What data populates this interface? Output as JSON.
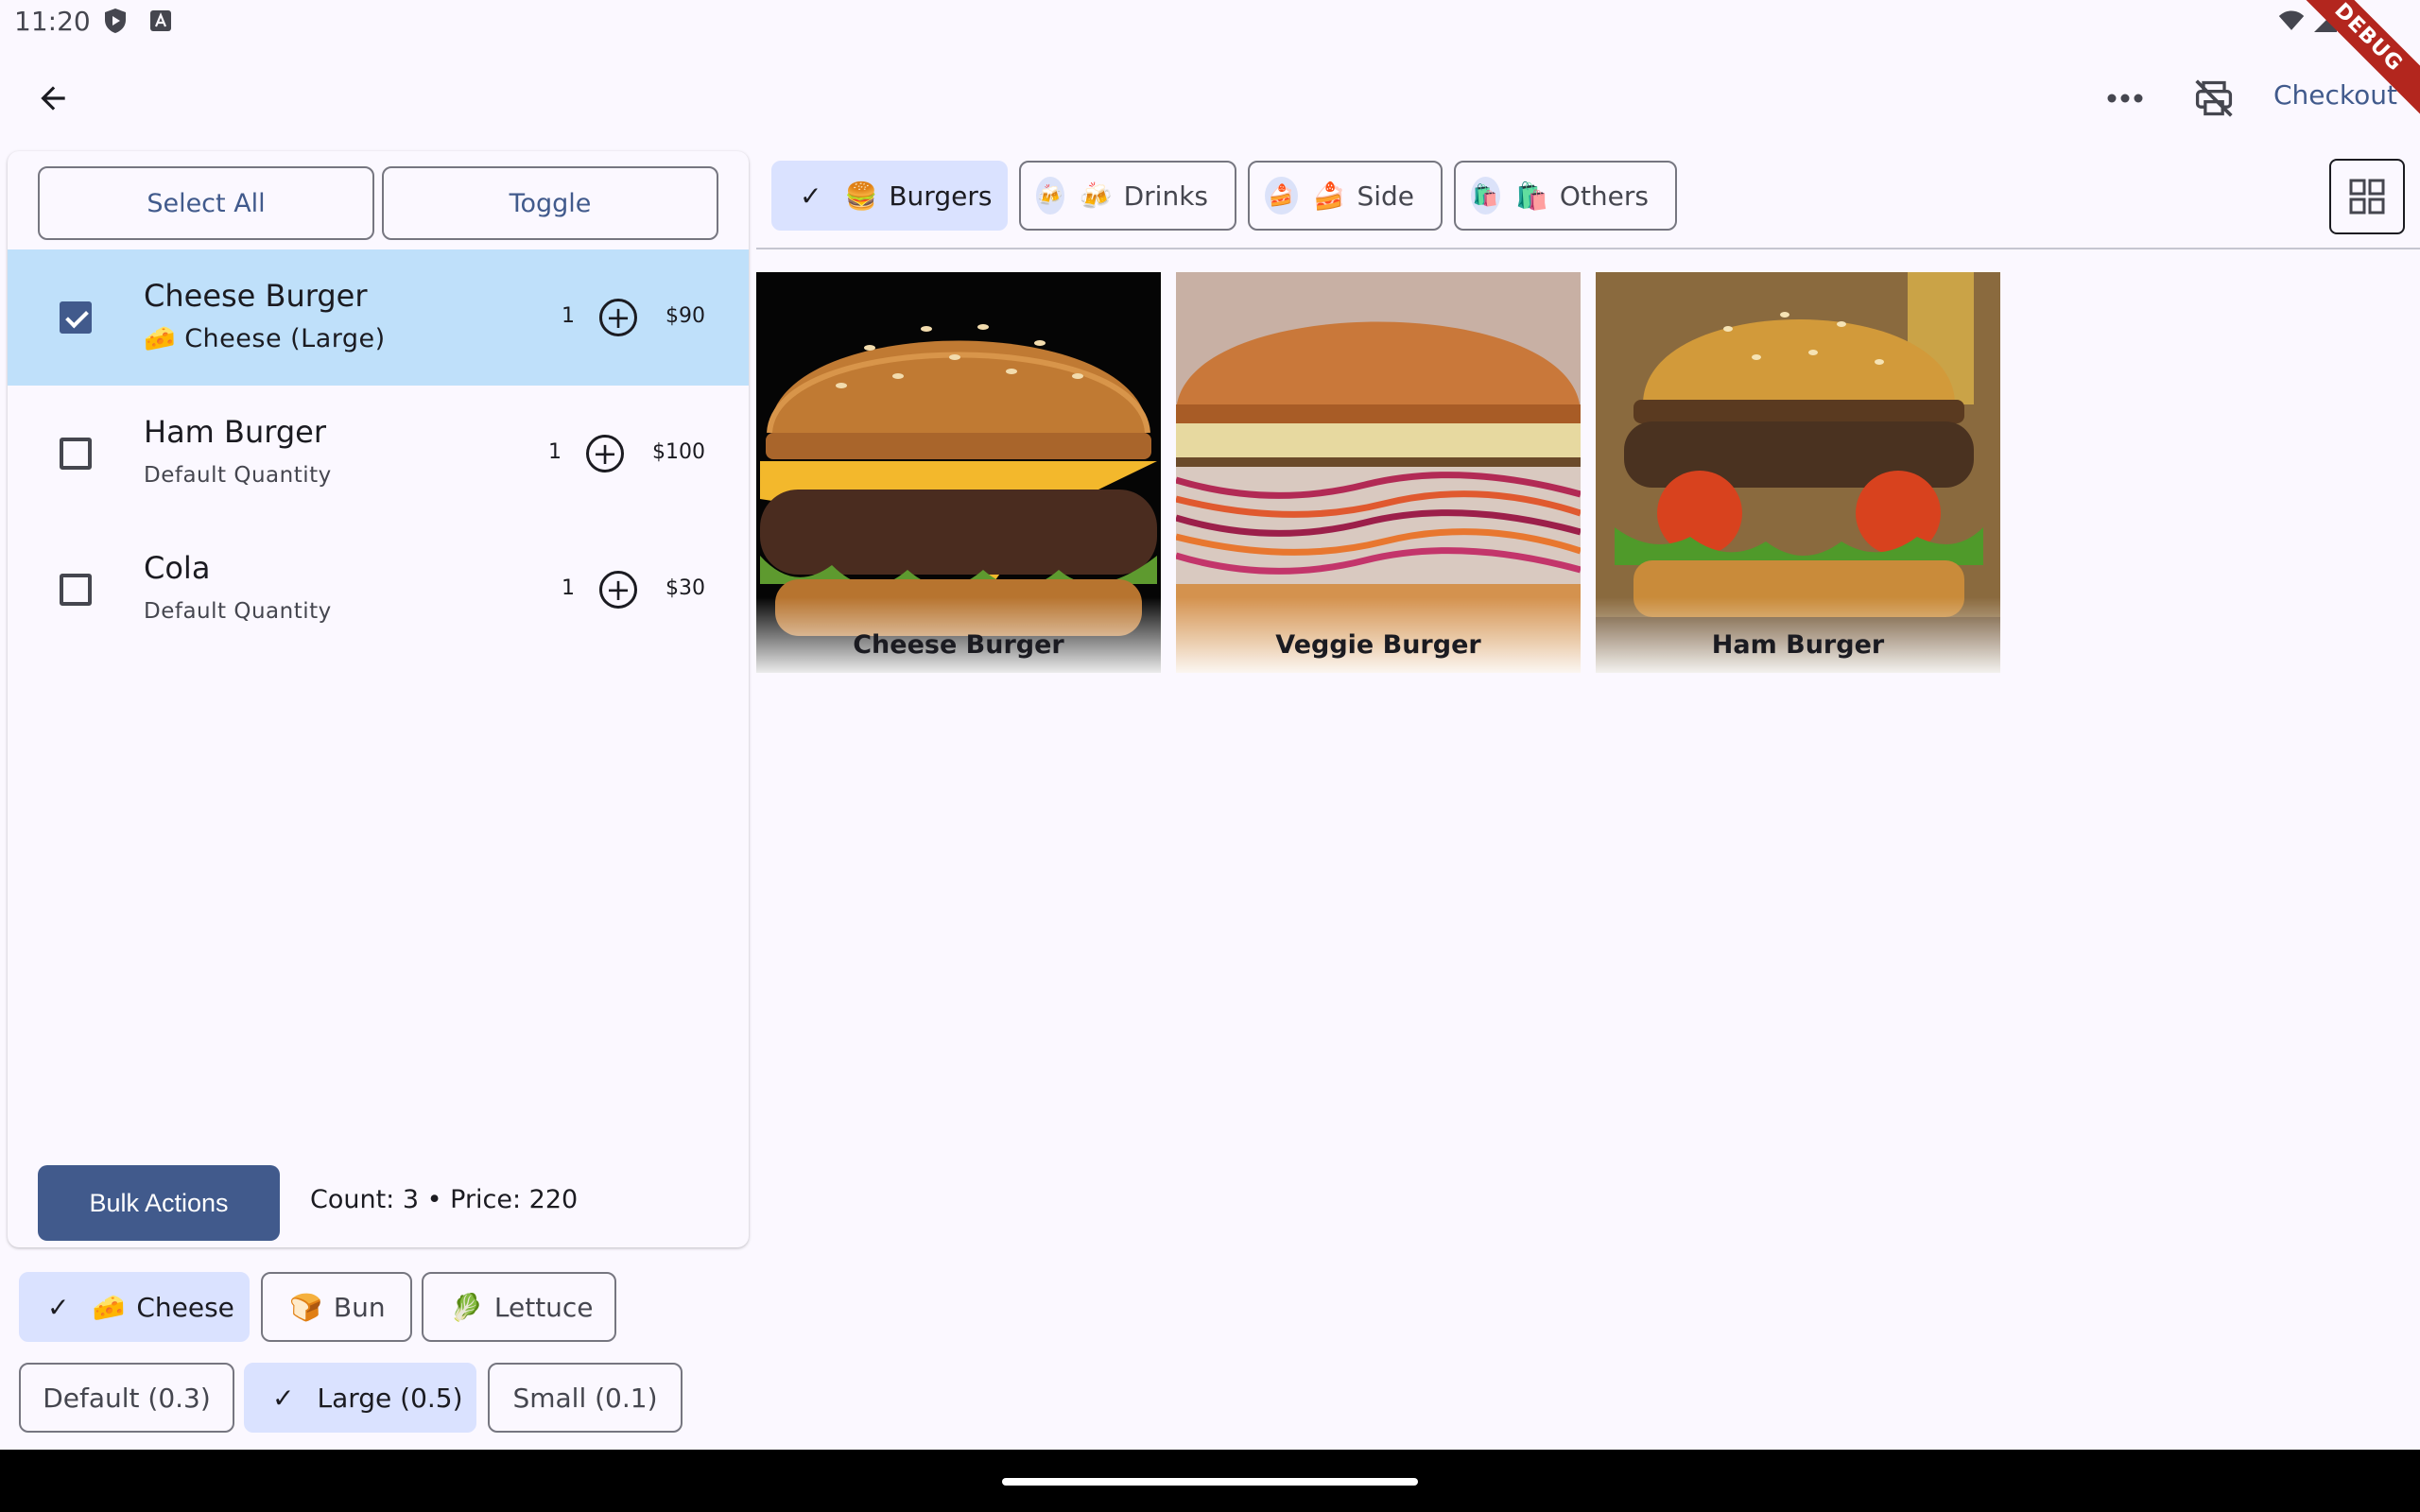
{
  "status_bar": {
    "time": "11:20",
    "debug_label": "DEBUG"
  },
  "app_bar": {
    "checkout_label": "Checkout"
  },
  "order_panel": {
    "select_all_label": "Select All",
    "toggle_label": "Toggle",
    "items": [
      {
        "name": "Cheese Burger",
        "detail": "🧀 Cheese (Large)",
        "qty": "1",
        "price": "$90",
        "checked": true
      },
      {
        "name": "Ham Burger",
        "detail": "Default Quantity",
        "qty": "1",
        "price": "$100",
        "checked": false
      },
      {
        "name": "Cola",
        "detail": "Default Quantity",
        "qty": "1",
        "price": "$30",
        "checked": false
      }
    ],
    "bulk_actions_label": "Bulk Actions",
    "summary": "Count: 3  •  Price: 220"
  },
  "ingredient_chips": [
    {
      "label": "Cheese",
      "emoji": "🧀",
      "selected": true
    },
    {
      "label": "Bun",
      "emoji": "🍞",
      "selected": false
    },
    {
      "label": "Lettuce",
      "emoji": "🥬",
      "selected": false
    }
  ],
  "quantity_chips": [
    {
      "label": "Default (0.3)",
      "selected": false
    },
    {
      "label": "Large (0.5)",
      "selected": true
    },
    {
      "label": "Small (0.1)",
      "selected": false
    }
  ],
  "categories": [
    {
      "label": "Burgers",
      "emoji": "🍔",
      "selected": true
    },
    {
      "label": "Drinks",
      "emoji": "🍻",
      "selected": false
    },
    {
      "label": "Side",
      "emoji": "🍰",
      "selected": false
    },
    {
      "label": "Others",
      "emoji": "🛍️",
      "selected": false
    }
  ],
  "products": [
    {
      "name": "Cheese Burger"
    },
    {
      "name": "Veggie Burger"
    },
    {
      "name": "Ham Burger"
    }
  ],
  "colors": {
    "primary": "#415a8c",
    "selected_row": "#bfe0fa",
    "chip_selected": "#dae2ff"
  }
}
